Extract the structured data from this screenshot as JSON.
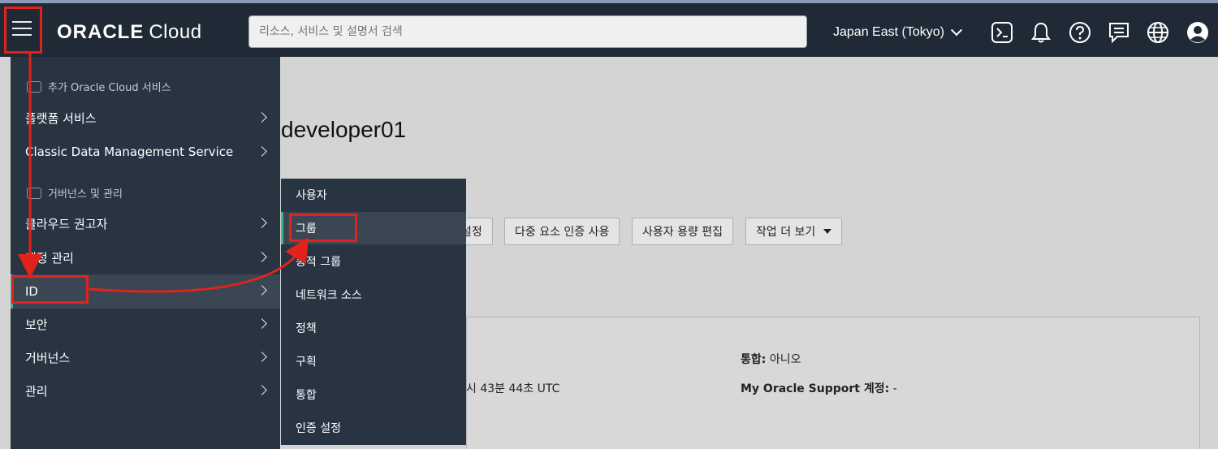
{
  "header": {
    "logo_main": "ORACLE",
    "logo_sub": "Cloud",
    "search_placeholder": "리소스, 서비스 및 설명서 검색",
    "region": "Japan East (Tokyo)"
  },
  "sidemenu": {
    "section1": "추가 Oracle Cloud 서비스",
    "section2": "거버넌스 및 관리",
    "items": [
      {
        "label": "플랫폼 서비스"
      },
      {
        "label": "Classic Data Management Service"
      },
      {
        "label": "클라우드 권고자"
      },
      {
        "label": "계정 관리"
      },
      {
        "label": "ID"
      },
      {
        "label": "보안"
      },
      {
        "label": "거버넌스"
      },
      {
        "label": "관리"
      }
    ]
  },
  "submenu": {
    "items": [
      {
        "label": "사용자"
      },
      {
        "label": "그룹"
      },
      {
        "label": "동적 그룹"
      },
      {
        "label": "네트워크 소스"
      },
      {
        "label": "정책"
      },
      {
        "label": "구획"
      },
      {
        "label": "통합"
      },
      {
        "label": "인증 설정"
      }
    ]
  },
  "page": {
    "title": "developer01",
    "buttons": {
      "setup": "설정",
      "mfa": "다중 요소 인증 사용",
      "quota": "사용자 용량 편집",
      "more": "작업 더 보기"
    },
    "info": {
      "federated_label": "통합:",
      "federated_value": "아니오",
      "time_fragment": "시 43분 44초 UTC",
      "support_label": "My Oracle Support 계정:",
      "support_value": "-"
    }
  },
  "colors": {
    "topbar": "#1f2a36",
    "menu": "#293443",
    "accent": "#3fb68e",
    "highlight": "#e0241c"
  }
}
